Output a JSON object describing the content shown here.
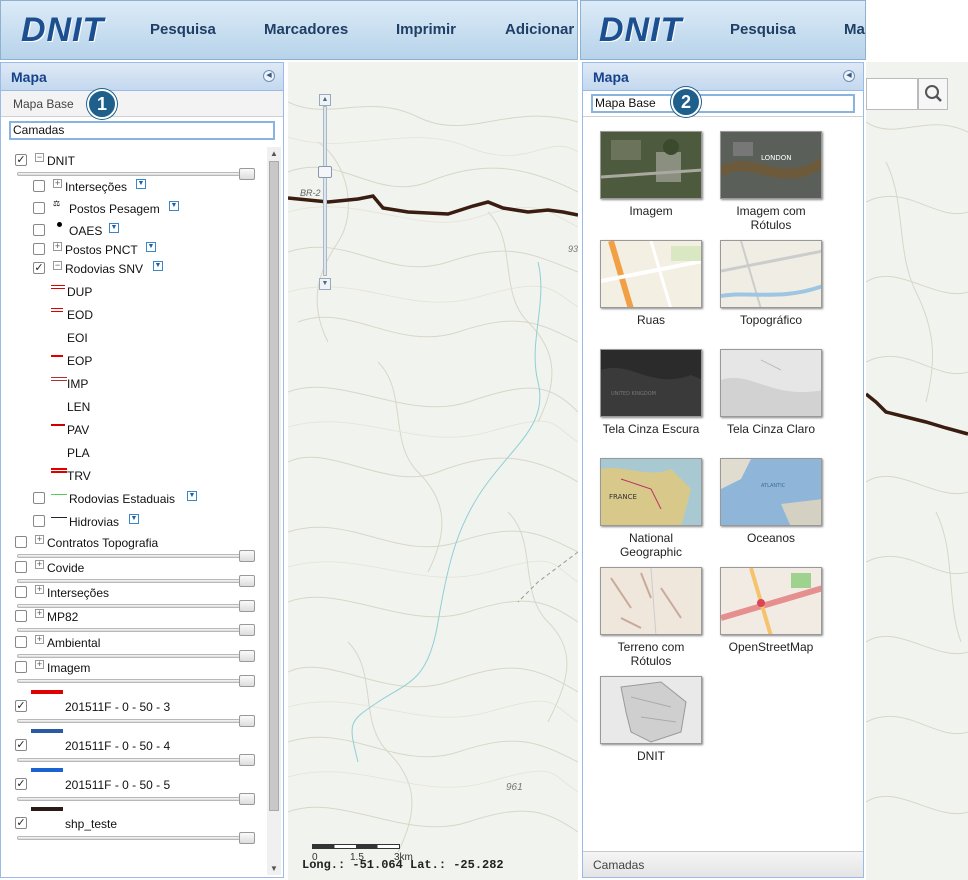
{
  "header": {
    "logo": "DNIT",
    "nav": [
      "Pesquisa",
      "Marcadores",
      "Imprimir",
      "Adicionar"
    ],
    "nav_right": [
      "Pesquisa",
      "Ma"
    ]
  },
  "left_panel": {
    "title": "Mapa",
    "tab_map_base": "Mapa Base",
    "tab_layers": "Camadas",
    "badge": "1",
    "tree": {
      "dnit_group": "DNIT",
      "sublayers": [
        "Interseções",
        "Postos Pesagem",
        "OAES",
        "Postos PNCT",
        "Rodovias SNV"
      ],
      "legend": [
        "DUP",
        "EOD",
        "EOI",
        "EOP",
        "IMP",
        "LEN",
        "PAV",
        "PLA",
        "TRV"
      ],
      "other_sub": [
        "Rodovias Estaduais",
        "Hidrovias"
      ],
      "groups": [
        "Contratos Topografia",
        "Covide",
        "Interseções",
        "MP82",
        "Ambiental",
        "Imagem"
      ],
      "shapes": [
        "201511F - 0 - 50 - 3",
        "201511F - 0 - 50 - 4",
        "201511F - 0 - 50 - 5",
        "shp_teste"
      ],
      "shape_colors": [
        "#e00000",
        "#2a5aa6",
        "#1b63d0",
        "#2b1a15"
      ]
    }
  },
  "map": {
    "label_br": "BR-2",
    "label_93": "93",
    "label_961": "961",
    "scale_ticks": [
      "0",
      "1.5",
      "3km"
    ],
    "coords": "Long.: -51.064 Lat.: -25.282"
  },
  "right_panel": {
    "title": "Mapa",
    "tab_map_base": "Mapa Base",
    "badge": "2",
    "footer": "Camadas",
    "basemaps": [
      {
        "label": "Imagem",
        "icon": "satellite-thumbnail"
      },
      {
        "label": "Imagem com Rótulos",
        "icon": "satellite-labels-thumbnail"
      },
      {
        "label": "Ruas",
        "icon": "streets-thumbnail"
      },
      {
        "label": "Topográfico",
        "icon": "topo-thumbnail"
      },
      {
        "label": "Tela Cinza Escura",
        "icon": "dark-gray-thumbnail"
      },
      {
        "label": "Tela Cinza Claro",
        "icon": "light-gray-thumbnail"
      },
      {
        "label": "National Geographic",
        "icon": "natgeo-thumbnail"
      },
      {
        "label": "Oceanos",
        "icon": "oceans-thumbnail"
      },
      {
        "label": "Terreno com Rótulos",
        "icon": "terrain-thumbnail"
      },
      {
        "label": "OpenStreetMap",
        "icon": "osm-thumbnail"
      },
      {
        "label": "DNIT",
        "icon": "dnit-thumbnail"
      }
    ]
  },
  "colors": {
    "header_blue": "#1c4f8f",
    "panel_title": "#15428b",
    "badge": "#1f5f8b",
    "road": "#3a1c10"
  }
}
